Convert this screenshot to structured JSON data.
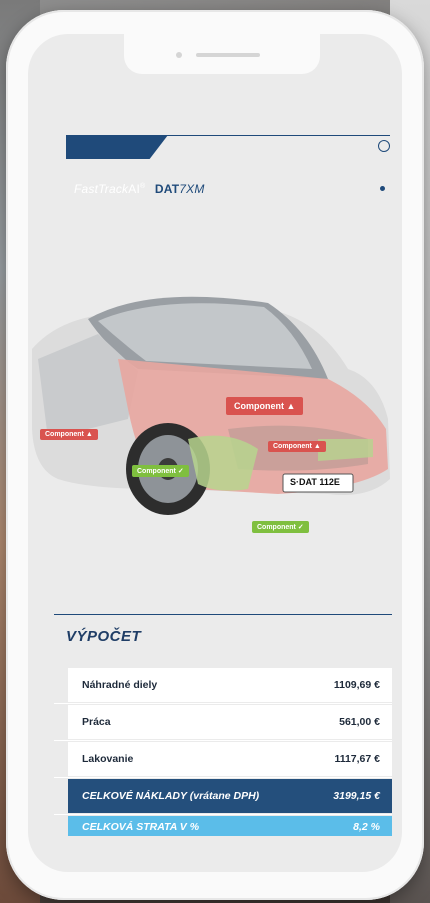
{
  "brand": {
    "fasttrack": "FastTrack",
    "ai": "AI",
    "reg": "®",
    "dat": "DAT",
    "seven": "7",
    "xm": "XM"
  },
  "car": {
    "tags": [
      "Component",
      "Component",
      "Component",
      "Component",
      "Component"
    ],
    "plate": "S·DAT 112E",
    "red_tag_icon": "warning-triangle-icon",
    "green_tag_icon": "check-icon"
  },
  "calculation": {
    "title": "VÝPOČET",
    "rows": [
      {
        "label": "Náhradné diely",
        "value": "1109,69 €"
      },
      {
        "label": "Práca",
        "value": "561,00 €"
      },
      {
        "label": "Lakovanie",
        "value": "1117,67 €"
      }
    ],
    "total": {
      "label": "CELKOVÉ NÁKLADY (vrátane DPH)",
      "value": "3199,15 €"
    },
    "loss": {
      "label": "CELKOVÁ STRATA V %",
      "value": "8,2 %"
    }
  },
  "colors": {
    "brand_blue": "#1f4a7a",
    "total_row": "#244f7c",
    "loss_row": "#5bbde9",
    "damage_red": "#d9534f",
    "ok_green": "#7fbf3f"
  }
}
